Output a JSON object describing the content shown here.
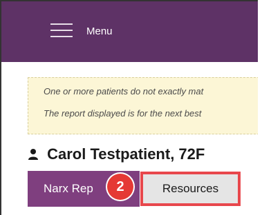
{
  "topbar": {
    "menu_label": "Menu",
    "menu_icon": "hamburger-icon"
  },
  "alert": {
    "line1": "One or more patients do not exactly mat",
    "line2": "The report displayed is for the next best"
  },
  "patient": {
    "name": "Carol Testpatient, 72F",
    "icon": "person-icon"
  },
  "tabs": [
    {
      "label": "Narx Rep",
      "selected": true
    },
    {
      "label": "Resources",
      "selected": false
    }
  ],
  "badge": {
    "number": "2"
  },
  "colors": {
    "topbar": "#5e3266",
    "tab_active": "#7f3f7f",
    "badge": "#e53935",
    "highlight": "#e8474c",
    "alert_bg": "#fcf6d6"
  }
}
